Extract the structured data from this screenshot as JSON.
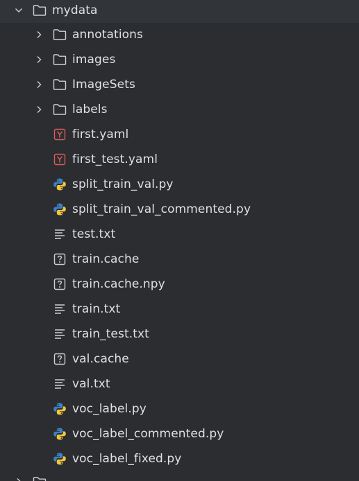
{
  "colors": {
    "background": "#2b2d30",
    "text": "#dfe1e5",
    "icon_gray": "#ced0d6",
    "yaml_red": "#db5c5c",
    "python_blue": "#3d7fc6",
    "python_yellow": "#f3c63c"
  },
  "tree": {
    "root": {
      "label": "mydata",
      "expanded": true,
      "icon": "folder-icon"
    },
    "folders": [
      {
        "label": "annotations",
        "icon": "folder-icon",
        "expanded": false
      },
      {
        "label": "images",
        "icon": "folder-icon",
        "expanded": false
      },
      {
        "label": "ImageSets",
        "icon": "folder-icon",
        "expanded": false
      },
      {
        "label": "labels",
        "icon": "folder-icon",
        "expanded": false
      }
    ],
    "files": [
      {
        "label": "first.yaml",
        "icon": "yaml-icon"
      },
      {
        "label": "first_test.yaml",
        "icon": "yaml-icon"
      },
      {
        "label": "split_train_val.py",
        "icon": "python-icon"
      },
      {
        "label": "split_train_val_commented.py",
        "icon": "python-icon"
      },
      {
        "label": "test.txt",
        "icon": "text-file-icon"
      },
      {
        "label": "train.cache",
        "icon": "unknown-file-icon"
      },
      {
        "label": "train.cache.npy",
        "icon": "unknown-file-icon"
      },
      {
        "label": "train.txt",
        "icon": "text-file-icon"
      },
      {
        "label": "train_test.txt",
        "icon": "text-file-icon"
      },
      {
        "label": "val.cache",
        "icon": "unknown-file-icon"
      },
      {
        "label": "val.txt",
        "icon": "text-file-icon"
      },
      {
        "label": "voc_label.py",
        "icon": "python-icon"
      },
      {
        "label": "voc_label_commented.py",
        "icon": "python-icon"
      },
      {
        "label": "voc_label_fixed.py",
        "icon": "python-icon"
      }
    ]
  }
}
